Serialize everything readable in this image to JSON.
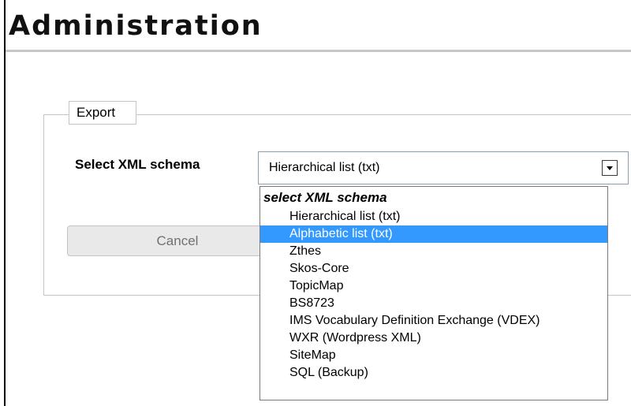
{
  "page": {
    "title": "Administration"
  },
  "export": {
    "legend": "Export",
    "schema_label": "Select XML schema",
    "selected_value": "Hierarchical list (txt)",
    "cancel_label": "Cancel"
  },
  "dropdown": {
    "group_label": "select XML schema",
    "highlighted_index": 1,
    "options": [
      "Hierarchical list (txt)",
      "Alphabetic list (txt)",
      "Zthes",
      "Skos-Core",
      "TopicMap",
      "BS8723",
      "IMS Vocabulary Definition Exchange (VDEX)",
      "WXR (Wordpress XML)",
      "SiteMap",
      "SQL (Backup)"
    ]
  },
  "colors": {
    "highlight": "#3399ff",
    "highlight_text": "#ffffff"
  },
  "icons": {
    "select_arrow": "chevron-down-icon"
  }
}
